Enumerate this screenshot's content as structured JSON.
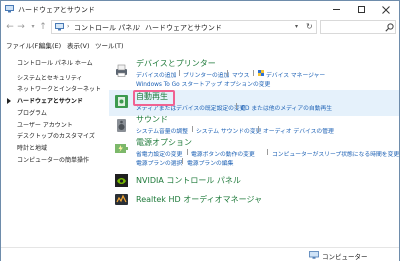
{
  "window": {
    "title": "ハードウェアとサウンド"
  },
  "address": {
    "crumbs": [
      "コントロール パネル",
      "ハードウェアとサウンド"
    ],
    "search_placeholder": ""
  },
  "menu": [
    "ファイル(F)",
    "編集(E)",
    "表示(V)",
    "ツール(T)"
  ],
  "nav": {
    "items": [
      "コントロール パネル ホーム",
      "システムとセキュリティ",
      "ネットワークとインターネット",
      "ハードウェアとサウンド",
      "プログラム",
      "ユーザー アカウント",
      "デスクトップのカスタマイズ",
      "時計と地域",
      "コンピューターの簡単操作"
    ],
    "current_index": 3
  },
  "categories": {
    "devices": {
      "title": "デバイスとプリンター",
      "links_row1": [
        "デバイスの追加",
        "プリンターの追加",
        "マウス",
        "デバイス マネージャー"
      ],
      "links_row2": [
        "Windows To Go スタートアップ オプションの変更"
      ]
    },
    "autoplay": {
      "title": "自動再生",
      "links": [
        "メディアまたはデバイスの既定設定の変更",
        "CD または他のメディアの自動再生"
      ]
    },
    "sound": {
      "title": "サウンド",
      "links": [
        "システム音量の調整",
        "システム サウンドの変更",
        "オーディオ デバイスの管理"
      ]
    },
    "power": {
      "title": "電源オプション",
      "links_row1": [
        "省電力設定の変更",
        "電源ボタンの動作の変更",
        "コンピューターがスリープ状態になる時間を変更"
      ],
      "links_row2": [
        "電源プランの選択",
        "電源プランの編集"
      ]
    },
    "nvidia": {
      "title": "NVIDIA コントロール パネル"
    },
    "realtek": {
      "title": "Realtek HD オーディオマネージャ"
    }
  },
  "status": {
    "label": "コンピューター"
  },
  "colors": {
    "category_title": "#1e7a3a",
    "link": "#1a5fb4",
    "highlight": "#e5f1fb",
    "annotation_box": "#f06292"
  }
}
